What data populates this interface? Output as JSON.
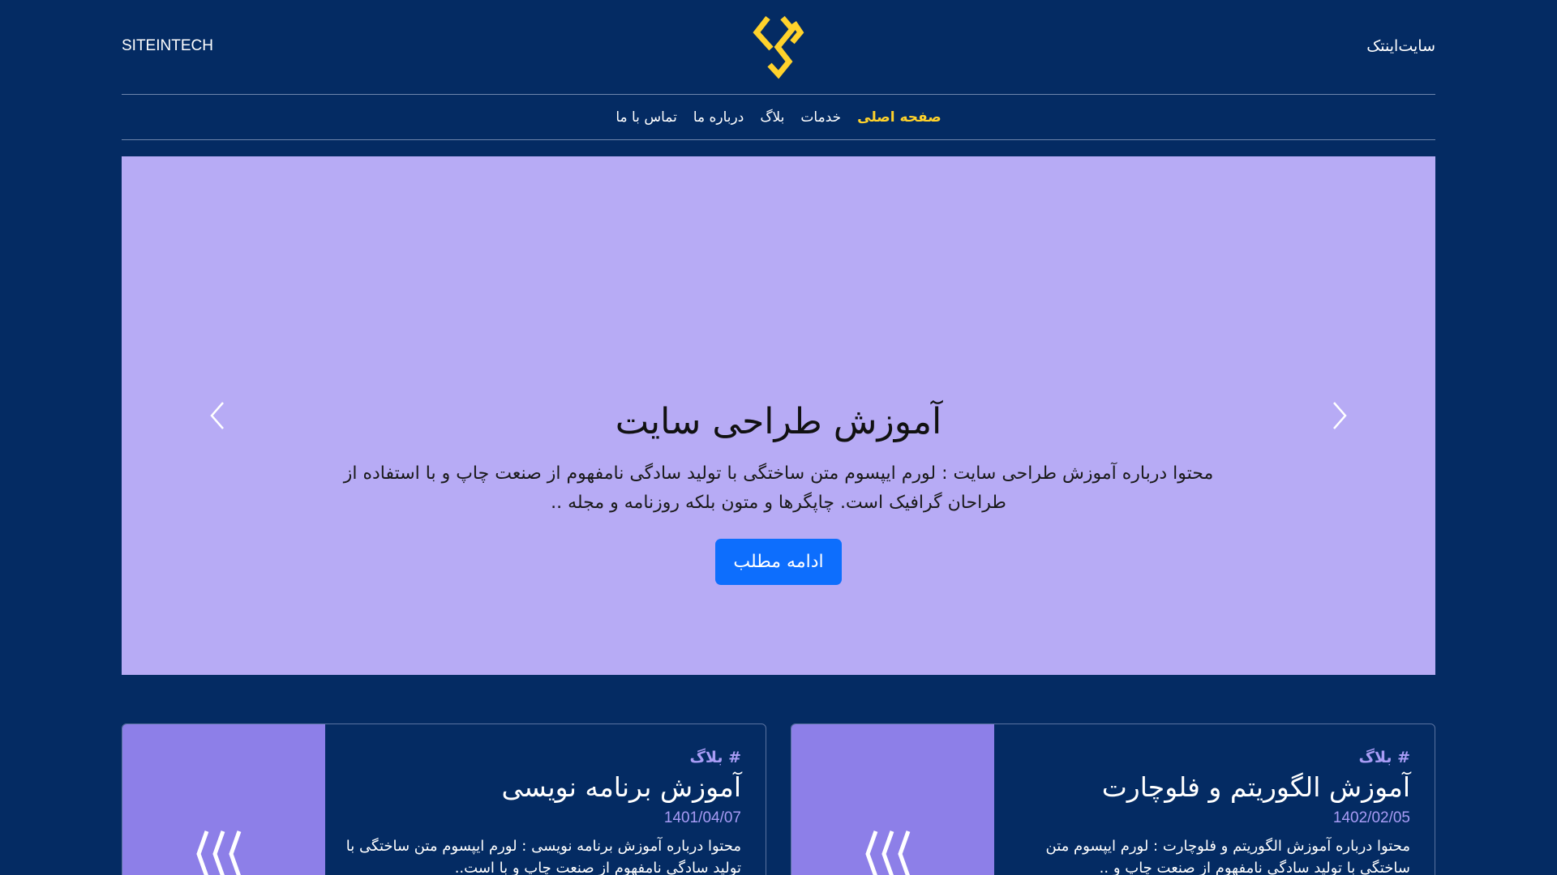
{
  "header": {
    "brand_en": "SITEINTECH",
    "brand_fa": "سایت‌اینتک"
  },
  "nav": {
    "items": [
      "صفحه اصلی",
      "خدمات",
      "بلاگ",
      "درباره ما",
      "تماس با ما"
    ],
    "active": "صفحه اصلی"
  },
  "hero": {
    "title": "آموزش طراحی سایت",
    "text": "محتوا درباره آموزش طراحی سایت : لورم ایپسوم متن ساختگی با تولید سادگی نامفهوم از صنعت چاپ و با استفاده از طراحان گرافیک است. چاپگرها و متون بلکه روزنامه و مجله ..",
    "button_label": "ادامه مطلب",
    "prev_icon": "chevron-left-icon",
    "next_icon": "chevron-right-icon"
  },
  "cards": [
    {
      "tag": "# بلاگ",
      "title": "آموزش الگوریتم و فلوچارت",
      "date": "1402/02/05",
      "text": "محتوا درباره آموزش الگوریتم و فلوچارت : لورم ایپسوم متن ساختگی با تولید سادگی نامفهوم از صنعت چاپ و .."
    },
    {
      "tag": "# بلاگ",
      "title": "آموزش برنامه نویسی",
      "date": "1401/04/07",
      "text": "محتوا درباره آموزش برنامه نویسی : لورم ایپسوم متن ساختگی با تولید سادگی نامفهوم از صنعت چاپ و با است.."
    }
  ],
  "colors": {
    "background": "#042b63",
    "accent": "#ffd22b",
    "hero_bg": "#b7abf5",
    "card_media": "#8d7fe8",
    "button": "#0d6efd"
  }
}
